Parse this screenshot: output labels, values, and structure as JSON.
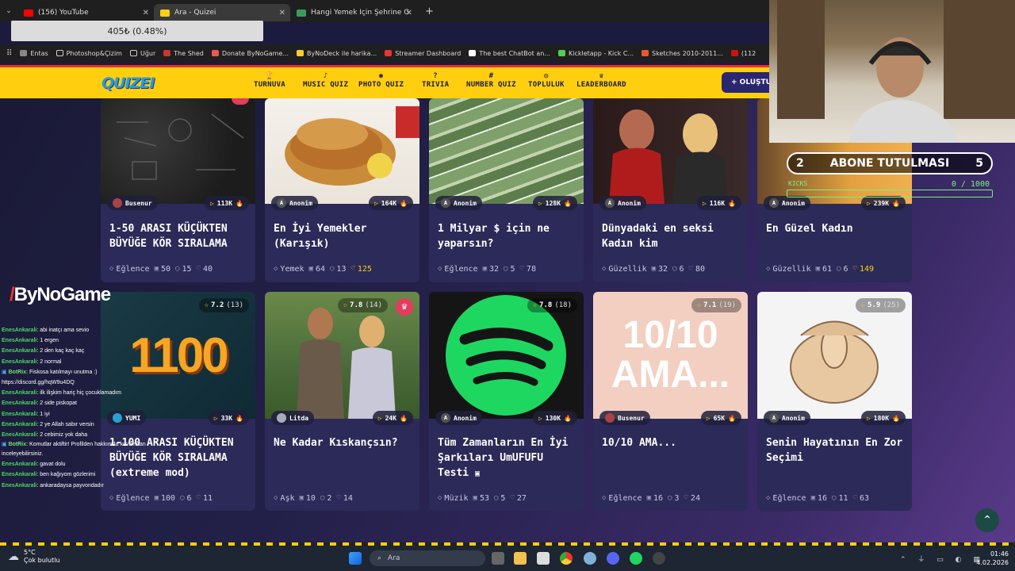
{
  "browser": {
    "tabs": [
      {
        "title": "(156) YouTube",
        "active": false
      },
      {
        "title": "Ara - Quizei",
        "active": true
      },
      {
        "title": "Hangi Yemek İçin Şehrine Gider",
        "active": false
      }
    ],
    "new_tab": "+",
    "download_overlay": "405₺ (0.48%)",
    "bookmarks": [
      "Entas",
      "Photoshop&Çizim",
      "Uğur",
      "The Shed",
      "Donate ByNoGame...",
      "ByNoDeck ile harika...",
      "Streamer Dashboard",
      "The best ChatBot an...",
      "Kickletapp - Kick C...",
      "Sketches 2010-2011...",
      "(112"
    ]
  },
  "site": {
    "logo": "QUIZEI",
    "nav": [
      {
        "icon": "trophy-icon",
        "glyph": "🏆",
        "label": "TURNUVA"
      },
      {
        "icon": "music-icon",
        "glyph": "♪",
        "label": "MUSIC QUIZ"
      },
      {
        "icon": "camera-icon",
        "glyph": "◉",
        "label": "PHOTO QUIZ"
      },
      {
        "icon": "question-icon",
        "glyph": "?",
        "label": "TRIVIA"
      },
      {
        "icon": "hash-icon",
        "glyph": "#",
        "label": "NUMBER QUIZ"
      },
      {
        "icon": "community-icon",
        "glyph": "◎",
        "label": "TOPLULUK"
      },
      {
        "icon": "medal-icon",
        "glyph": "♛",
        "label": "LEADERBOARD"
      }
    ],
    "create_button": "+ OLUŞTU"
  },
  "cards_row1": [
    {
      "author": "Busenur",
      "plays": "113K",
      "title": "1-50 ARASI KÜÇÜKTEN BÜYÜĞE KÖR SIRALAMA",
      "category": "Eğlence",
      "questions": "50",
      "comments": "15",
      "likes": "40",
      "liked": false
    },
    {
      "author": "Anonim",
      "plays": "164K",
      "title": "En İyi Yemekler (Karışık)",
      "category": "Yemek",
      "questions": "64",
      "comments": "13",
      "likes": "125",
      "liked": true
    },
    {
      "author": "Anonim",
      "plays": "128K",
      "title": "1 Milyar $ için ne yaparsın?",
      "category": "Eğlence",
      "questions": "32",
      "comments": "5",
      "likes": "78",
      "liked": false
    },
    {
      "author": "Anonim",
      "plays": "116K",
      "title": "Dünyadaki en seksi Kadın kim",
      "category": "Güzellik",
      "questions": "32",
      "comments": "6",
      "likes": "80",
      "liked": false
    },
    {
      "author": "Anonim",
      "plays": "239K",
      "title": "En Güzel Kadın",
      "category": "Güzellik",
      "questions": "61",
      "comments": "6",
      "likes": "149",
      "liked": true
    }
  ],
  "cards_row2": [
    {
      "rating": "7.2",
      "votes": "(13)",
      "author": "YUMI",
      "plays": "33K",
      "title": "1-100 ARASI KÜÇÜKTEN BÜYÜĞE KÖR SIRALAMA (extreme mod)",
      "category": "Eğlence",
      "questions": "100",
      "comments": "6",
      "likes": "11",
      "image_text": "1100",
      "crown": false
    },
    {
      "rating": "7.8",
      "votes": "(14)",
      "author": "Litda",
      "plays": "24K",
      "title": "Ne Kadar Kıskançsın?",
      "category": "Aşk",
      "questions": "10",
      "comments": "2",
      "likes": "14",
      "image_text": "",
      "crown": true
    },
    {
      "rating": "7.8",
      "votes": "(18)",
      "author": "Anonim",
      "plays": "130K",
      "title": "Tüm Zamanların En İyi Şarkıları UmUFUFU Testi",
      "category": "Müzik",
      "questions": "53",
      "comments": "5",
      "likes": "27",
      "image_text": "",
      "crown": false
    },
    {
      "rating": "7.1",
      "votes": "(19)",
      "author": "Busenur",
      "plays": "65K",
      "title": "10/10 AMA...",
      "category": "Eğlence",
      "questions": "16",
      "comments": "3",
      "likes": "24",
      "image_text": "10/10 AMA...",
      "crown": false
    },
    {
      "rating": "5.9",
      "votes": "(25)",
      "author": "Anonim",
      "plays": "180K",
      "title": "Senin Hayatının En Zor Seçimi",
      "category": "Eğlence",
      "questions": "16",
      "comments": "11",
      "likes": "63",
      "image_text": "",
      "crown": false
    }
  ],
  "stream": {
    "brand": "ByNoGame",
    "sub_goal": {
      "left": "2",
      "label": "ABONE TUTULMASI",
      "right": "5",
      "progress": "0 / 1000",
      "sub_label": "KICKS"
    },
    "chat": [
      {
        "user": "EnesAnkarali",
        "msg": ": abi inatçı ama sevio"
      },
      {
        "user": "EnesAnkarali",
        "msg": ": 1 ergen"
      },
      {
        "user": "EnesAnkarali",
        "msg": ": 2 den kaç kaç kaç"
      },
      {
        "user": "EnesAnkarali",
        "msg": ": 2 normal"
      },
      {
        "user": "BotRix",
        "msg": ": Fiskosa katılmayı unutma :) https://discord.gg/hqW9u4DQ",
        "bot": true
      },
      {
        "user": "EnesAnkarali",
        "msg": ": ilk ilişkim hariç hiç çocuklamadım"
      },
      {
        "user": "EnesAnkarali",
        "msg": ": 2 side piskopat"
      },
      {
        "user": "EnesAnkarali",
        "msg": ": 1 iyi"
      },
      {
        "user": "EnesAnkarali",
        "msg": ": 2 ye Allah sabır versin"
      },
      {
        "user": "EnesAnkarali",
        "msg": ": 2 cebimiz yok daha"
      },
      {
        "user": "BotRix",
        "msg": ": Komutlar aktiftir! Profilden hakkımda kısmından inceleyebilirsiniz.",
        "bot": true
      },
      {
        "user": "EnesAnkarali",
        "msg": ": gavat dolu"
      },
      {
        "user": "EnesAnkarali",
        "msg": ": ben kağıyom gözlerimi"
      },
      {
        "user": "EnesAnkarali",
        "msg": ": ankaradaysa payvondadır"
      }
    ]
  },
  "taskbar": {
    "weather_temp": "5°C",
    "weather_desc": "Çok bulutlu",
    "search_placeholder": "Ara",
    "time": "01:46",
    "date": "4.02.2026"
  }
}
